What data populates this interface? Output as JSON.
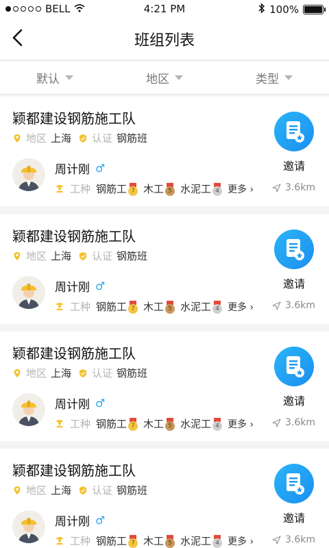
{
  "status_bar": {
    "carrier": "BELL",
    "time": "4:21 PM",
    "battery": "100%"
  },
  "header": {
    "title": "班组列表"
  },
  "filters": [
    "默认",
    "地区",
    "类型"
  ],
  "cards": [
    {
      "team_name": "颖都建设钢筋施工队",
      "region_label": "地区",
      "region_value": "上海",
      "cert_label": "认证",
      "team_type": "钢筋班",
      "person_name": "周计刚",
      "gender_symbol": "♂",
      "trade_label": "工种",
      "skills": [
        {
          "name": "钢筋工",
          "level": "7",
          "medal": "gold"
        },
        {
          "name": "木工",
          "level": "5",
          "medal": "bronze"
        },
        {
          "name": "水泥工",
          "level": "4",
          "medal": "silver"
        }
      ],
      "more": "更多",
      "distance": "3.6km",
      "invite": "邀请"
    },
    {
      "team_name": "颖都建设钢筋施工队",
      "region_label": "地区",
      "region_value": "上海",
      "cert_label": "认证",
      "team_type": "钢筋班",
      "person_name": "周计刚",
      "gender_symbol": "♂",
      "trade_label": "工种",
      "skills": [
        {
          "name": "钢筋工",
          "level": "7",
          "medal": "gold"
        },
        {
          "name": "木工",
          "level": "5",
          "medal": "bronze"
        },
        {
          "name": "水泥工",
          "level": "4",
          "medal": "silver"
        }
      ],
      "more": "更多",
      "distance": "3.6km",
      "invite": "邀请"
    },
    {
      "team_name": "颖都建设钢筋施工队",
      "region_label": "地区",
      "region_value": "上海",
      "cert_label": "认证",
      "team_type": "钢筋班",
      "person_name": "周计刚",
      "gender_symbol": "♂",
      "trade_label": "工种",
      "skills": [
        {
          "name": "钢筋工",
          "level": "7",
          "medal": "gold"
        },
        {
          "name": "木工",
          "level": "5",
          "medal": "bronze"
        },
        {
          "name": "水泥工",
          "level": "4",
          "medal": "silver"
        }
      ],
      "more": "更多",
      "distance": "3.6km",
      "invite": "邀请"
    },
    {
      "team_name": "颖都建设钢筋施工队",
      "region_label": "地区",
      "region_value": "上海",
      "cert_label": "认证",
      "team_type": "钢筋班",
      "person_name": "周计刚",
      "gender_symbol": "♂",
      "trade_label": "工种",
      "skills": [
        {
          "name": "钢筋工",
          "level": "7",
          "medal": "gold"
        },
        {
          "name": "木工",
          "level": "5",
          "medal": "bronze"
        },
        {
          "name": "水泥工",
          "level": "4",
          "medal": "silver"
        }
      ],
      "more": "更多",
      "distance": "3.6km",
      "invite": "邀请"
    }
  ],
  "colors": {
    "accent_blue": "#1e9bf2",
    "accent_yellow": "#f5c12e"
  }
}
